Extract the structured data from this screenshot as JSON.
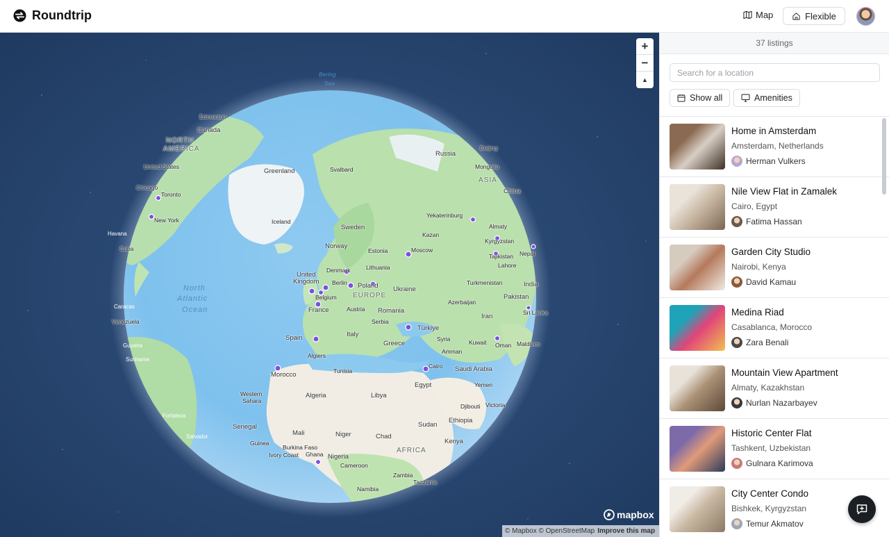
{
  "header": {
    "brand_title": "Roundtrip",
    "map_label": "Map",
    "flexible_label": "Flexible"
  },
  "map": {
    "zoom_in": "+",
    "zoom_out": "−",
    "reset_north": "▲",
    "mapbox_logo": "mapbox",
    "attribution": "© Mapbox © OpenStreetMap",
    "improve": "Improve this map",
    "labels": [
      {
        "t": "Bering",
        "cls": "sea"
      },
      {
        "t": "Sea",
        "cls": "sea"
      },
      {
        "t": "Edmonton",
        "cls": ""
      },
      {
        "t": "Canada",
        "cls": "country"
      },
      {
        "t": "NORTH",
        "cls": "big"
      },
      {
        "t": "AMERICA",
        "cls": "big"
      },
      {
        "t": "United States",
        "cls": ""
      },
      {
        "t": "Chicago",
        "cls": ""
      },
      {
        "t": "Toronto",
        "cls": ""
      },
      {
        "t": "New York",
        "cls": ""
      },
      {
        "t": "Havana",
        "cls": "white"
      },
      {
        "t": "Cuba",
        "cls": ""
      },
      {
        "t": "Greenland",
        "cls": "country"
      },
      {
        "t": "Svalbard",
        "cls": ""
      },
      {
        "t": "Russia",
        "cls": "country"
      },
      {
        "t": "Beijing",
        "cls": ""
      },
      {
        "t": "Mongolia",
        "cls": ""
      },
      {
        "t": "ASIA",
        "cls": "big"
      },
      {
        "t": "China",
        "cls": "country"
      },
      {
        "t": "Iceland",
        "cls": ""
      },
      {
        "t": "Sweden",
        "cls": "country"
      },
      {
        "t": "Yekaterinburg",
        "cls": ""
      },
      {
        "t": "Kazan",
        "cls": ""
      },
      {
        "t": "Almaty",
        "cls": ""
      },
      {
        "t": "Kyrgyzstan",
        "cls": ""
      },
      {
        "t": "Norway",
        "cls": "country"
      },
      {
        "t": "Estonia",
        "cls": ""
      },
      {
        "t": "Moscow",
        "cls": ""
      },
      {
        "t": "Tajikistan",
        "cls": ""
      },
      {
        "t": "Nepal",
        "cls": ""
      },
      {
        "t": "Denmark",
        "cls": ""
      },
      {
        "t": "Lithuania",
        "cls": ""
      },
      {
        "t": "Lahore",
        "cls": ""
      },
      {
        "t": "United",
        "cls": "country"
      },
      {
        "t": "Kingdom",
        "cls": "country"
      },
      {
        "t": "Berlin",
        "cls": ""
      },
      {
        "t": "Poland",
        "cls": "country"
      },
      {
        "t": "Ukraine",
        "cls": "country"
      },
      {
        "t": "Turkmenistan",
        "cls": ""
      },
      {
        "t": "India",
        "cls": "country"
      },
      {
        "t": "North",
        "cls": "ocean"
      },
      {
        "t": "Atlantic",
        "cls": "ocean"
      },
      {
        "t": "Ocean",
        "cls": "ocean"
      },
      {
        "t": "Belgium",
        "cls": ""
      },
      {
        "t": "EUROPE",
        "cls": "big"
      },
      {
        "t": "Austria",
        "cls": ""
      },
      {
        "t": "Romania",
        "cls": "country"
      },
      {
        "t": "Azerbaijan",
        "cls": ""
      },
      {
        "t": "Pakistan",
        "cls": "country"
      },
      {
        "t": "France",
        "cls": "country"
      },
      {
        "t": "Caracas",
        "cls": "white"
      },
      {
        "t": "Venezuela",
        "cls": ""
      },
      {
        "t": "Serbia",
        "cls": ""
      },
      {
        "t": "Iran",
        "cls": "country"
      },
      {
        "t": "Sri Lanka",
        "cls": ""
      },
      {
        "t": "Türkiye",
        "cls": "country"
      },
      {
        "t": "Spain",
        "cls": "country"
      },
      {
        "t": "Italy",
        "cls": "country"
      },
      {
        "t": "Syria",
        "cls": ""
      },
      {
        "t": "Kuwait",
        "cls": ""
      },
      {
        "t": "Guyana",
        "cls": "white"
      },
      {
        "t": "Greece",
        "cls": "country"
      },
      {
        "t": "Oman",
        "cls": ""
      },
      {
        "t": "Maldives",
        "cls": ""
      },
      {
        "t": "Amman",
        "cls": ""
      },
      {
        "t": "Suriname",
        "cls": "white"
      },
      {
        "t": "Algiers",
        "cls": ""
      },
      {
        "t": "Cairo",
        "cls": ""
      },
      {
        "t": "Tunisia",
        "cls": ""
      },
      {
        "t": "Saudi Arabia",
        "cls": "country"
      },
      {
        "t": "Morocco",
        "cls": "country"
      },
      {
        "t": "Egypt",
        "cls": "country"
      },
      {
        "t": "Yemen",
        "cls": ""
      },
      {
        "t": "Western",
        "cls": ""
      },
      {
        "t": "Sahara",
        "cls": ""
      },
      {
        "t": "Algeria",
        "cls": "country"
      },
      {
        "t": "Libya",
        "cls": "country"
      },
      {
        "t": "Djibouti",
        "cls": ""
      },
      {
        "t": "Victoria",
        "cls": ""
      },
      {
        "t": "Fortaleza",
        "cls": "white"
      },
      {
        "t": "Sudan",
        "cls": "country"
      },
      {
        "t": "Ethiopia",
        "cls": "country"
      },
      {
        "t": "Senegal",
        "cls": "country"
      },
      {
        "t": "Mali",
        "cls": "country"
      },
      {
        "t": "Niger",
        "cls": "country"
      },
      {
        "t": "Chad",
        "cls": "country"
      },
      {
        "t": "Salvador",
        "cls": "white"
      },
      {
        "t": "Guinea",
        "cls": ""
      },
      {
        "t": "Burkina Faso",
        "cls": ""
      },
      {
        "t": "Kenya",
        "cls": "country"
      },
      {
        "t": "AFRICA",
        "cls": "big"
      },
      {
        "t": "Ivory Coast",
        "cls": ""
      },
      {
        "t": "Ghana",
        "cls": ""
      },
      {
        "t": "Nigeria",
        "cls": "country"
      },
      {
        "t": "Cameroon",
        "cls": ""
      },
      {
        "t": "Zambia",
        "cls": ""
      },
      {
        "t": "Tanzania",
        "cls": ""
      },
      {
        "t": "Namibia",
        "cls": ""
      }
    ]
  },
  "panel": {
    "listings_count": "37 listings",
    "search_placeholder": "Search for a location",
    "show_all_label": "Show all",
    "amenities_label": "Amenities",
    "listings": [
      {
        "title": "Home in Amsterdam",
        "location": "Amsterdam, Netherlands",
        "host": "Herman Vulkers",
        "thumb": [
          "#8a6a52",
          "#d8cfc4",
          "#3d2f24"
        ],
        "avatar": "#b9a5d6"
      },
      {
        "title": "Nile View Flat in Zamalek",
        "location": "Cairo, Egypt",
        "host": "Fatima Hassan",
        "thumb": [
          "#e9e3da",
          "#c9b8a4",
          "#7a6653"
        ],
        "avatar": "#6b5a4c"
      },
      {
        "title": "Garden City Studio",
        "location": "Nairobi, Kenya",
        "host": "David Kamau",
        "thumb": [
          "#d6cbbf",
          "#b47a5c",
          "#f1ece6"
        ],
        "avatar": "#8a5a3b"
      },
      {
        "title": "Medina Riad",
        "location": "Casablanca, Morocco",
        "host": "Zara Benali",
        "thumb": [
          "#1fa3b8",
          "#e0457a",
          "#f2c14e"
        ],
        "avatar": "#4a4a4a"
      },
      {
        "title": "Mountain View Apartment",
        "location": "Almaty, Kazakhstan",
        "host": "Nurlan Nazarbayev",
        "thumb": [
          "#e8e2d9",
          "#a98f74",
          "#5d4a3a"
        ],
        "avatar": "#3a3a3a"
      },
      {
        "title": "Historic Center Flat",
        "location": "Tashkent, Uzbekistan",
        "host": "Gulnara Karimova",
        "thumb": [
          "#7d6aa8",
          "#e09a7a",
          "#2b3b5a"
        ],
        "avatar": "#c77a7a"
      },
      {
        "title": "City Center Condo",
        "location": "Bishkek, Kyrgyzstan",
        "host": "Temur Akmatov",
        "thumb": [
          "#f0ece6",
          "#c6b59f",
          "#8c7a66"
        ],
        "avatar": "#9aa7b8"
      }
    ]
  }
}
